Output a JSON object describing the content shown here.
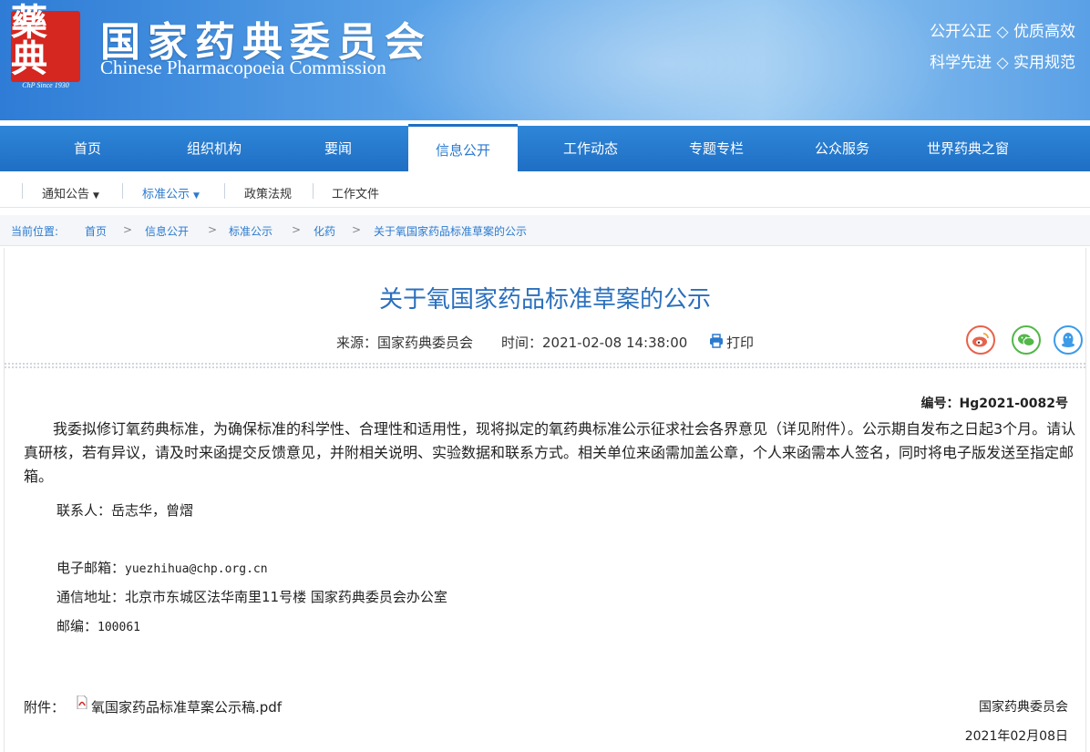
{
  "header": {
    "seal_glyph": "藥典",
    "seal_since": "ChP Since 1930",
    "title": "国家药典委员会",
    "subtitle": "Chinese Pharmacopoeia Commission",
    "slogan_line1": "公开公正 ◇ 优质高效",
    "slogan_line2": "科学先进 ◇ 实用规范"
  },
  "nav": {
    "items": [
      {
        "label": "首页"
      },
      {
        "label": "组织机构"
      },
      {
        "label": "要闻"
      },
      {
        "label": "信息公开",
        "active": true
      },
      {
        "label": "工作动态"
      },
      {
        "label": "专题专栏"
      },
      {
        "label": "公众服务"
      },
      {
        "label": "世界药典之窗"
      }
    ]
  },
  "subnav": {
    "items": [
      {
        "label": "通知公告"
      },
      {
        "label": "标准公示"
      },
      {
        "label": "政策法规"
      },
      {
        "label": "工作文件"
      }
    ]
  },
  "breadcrumb": {
    "prefix": "当前位置:",
    "items": [
      "首页",
      "信息公开",
      "标准公示",
      "化药",
      "关于氧国家药品标准草案的公示"
    ],
    "separator": ">"
  },
  "article": {
    "title": "关于氧国家药品标准草案的公示",
    "source_label": "来源：国家药典委员会",
    "time_label": "时间：2021-02-08 14:38:00",
    "print_label": "打印",
    "doc_number": "编号：Hg2021-0082号",
    "body": "我委拟修订氧药典标准，为确保标准的科学性、合理性和适用性，现将拟定的氧药典标准公示征求社会各界意见（详见附件）。公示期自发布之日起3个月。请认真研核，若有异议，请及时来函提交反馈意见，并附相关说明、实验数据和联系方式。相关单位来函需加盖公章，个人来函需本人签名，同时将电子版发送至指定邮箱。",
    "contact_label": "联系人：岳志华，曾熠",
    "email_label": "电子邮箱：",
    "email_value": "yuezhihua@chp.org.cn",
    "address_label": "通信地址：北京市东城区法华南里11号楼 国家药典委员会办公室",
    "postcode_label": "邮编：",
    "postcode_value": "100061",
    "attachment_label": "附件：",
    "attachment_name": "氧国家药品标准草案公示稿.pdf",
    "signer": "国家药典委员会",
    "date": "2021年02月08日"
  },
  "colors": {
    "accent": "#2a7ad0",
    "title_blue": "#2a6fbd",
    "seal_red": "#d5261f"
  },
  "icons": [
    "print-icon",
    "weibo-icon",
    "wechat-icon",
    "qq-icon",
    "pdf-icon",
    "caret-down-icon"
  ]
}
